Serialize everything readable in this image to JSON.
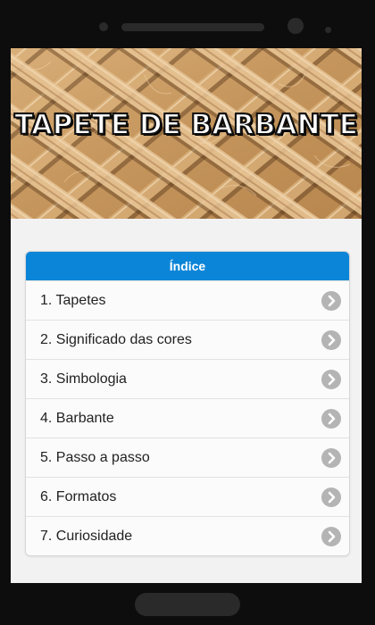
{
  "banner": {
    "title": "TAPETE DE BARBANTE",
    "image": "jute-twine-texture"
  },
  "index": {
    "header": "Índice",
    "items": [
      {
        "label": "1. Tapetes",
        "icon": "chevron-right-icon"
      },
      {
        "label": "2. Significado das cores",
        "icon": "chevron-right-icon"
      },
      {
        "label": "3. Simbologia",
        "icon": "chevron-right-icon"
      },
      {
        "label": "4. Barbante",
        "icon": "chevron-right-icon"
      },
      {
        "label": "5. Passo a passo",
        "icon": "chevron-right-icon"
      },
      {
        "label": "6. Formatos",
        "icon": "chevron-right-icon"
      },
      {
        "label": "7. Curiosidade",
        "icon": "chevron-right-icon"
      }
    ]
  },
  "colors": {
    "header_blue": "#0b85d8",
    "background": "#f2f2f2",
    "arrow_gray": "#b4b4b4"
  }
}
